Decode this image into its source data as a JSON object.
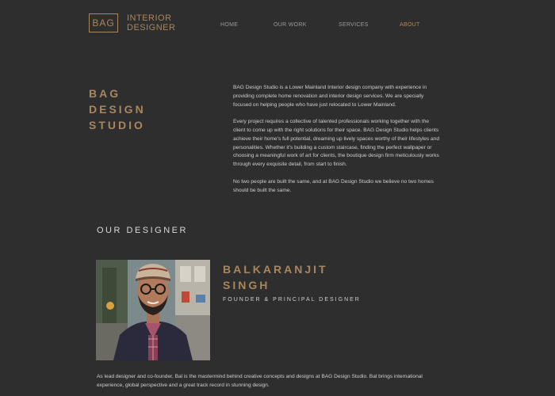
{
  "header": {
    "logo": {
      "box_text": "BAG",
      "line1": "INTERIOR",
      "line2": "DESIGNER"
    },
    "nav": [
      {
        "label": "HOME",
        "active": false
      },
      {
        "label": "OUR WORK",
        "active": false
      },
      {
        "label": "SERVICES",
        "active": false
      },
      {
        "label": "ABOUT",
        "active": true
      }
    ]
  },
  "studio": {
    "title_lines": [
      "BAG",
      "DESIGN",
      "STUDIO"
    ],
    "paragraphs": [
      "BAG Design Studio is a Lower Mainland Interior design company with experience in providing complete home renovation and interior design services. We are specially focused on helping people who have just relocated to Lower Mainland.",
      "Every project requires a collective of talented professionals working together with the client to come up with the right solutions for their space. BAG Design Studio helps clients achieve their home's full potential, dreaming up lively spaces worthy of their lifestyles and personalities. Whether it's building a custom staircase, finding the perfect wallpaper or choosing a meaningful work of art for clients, the boutique design firm meticulously works through every exquisite detail, from start to finish.",
      "No two people are built the same, and at BAG Design Studio we believe no two homes should be built the same."
    ]
  },
  "designer": {
    "section_heading": "OUR DESIGNER",
    "name_lines": [
      "BALKARANJIT",
      "SINGH"
    ],
    "role": "FOUNDER & PRINCIPAL DESIGNER",
    "bio": "As lead designer and co-founder, Bal is the mastermind behind creative concepts and designs at BAG Design Studio. Bal brings international experience, global perspective and a great track record in stunning design."
  },
  "colors": {
    "background": "#2e2e2e",
    "accent": "#a8865e",
    "text": "#cfcfcf",
    "nav_text": "#9a9a9a"
  }
}
